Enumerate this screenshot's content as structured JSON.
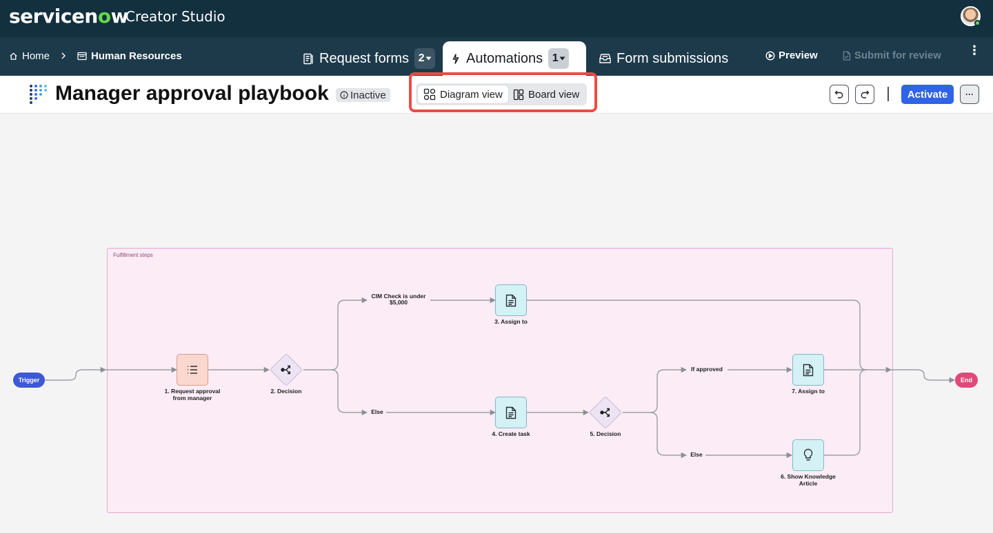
{
  "app": {
    "brand_name_prefix": "servicen",
    "brand_name_o": "o",
    "brand_name_suffix": "w",
    "product": "Creator Studio"
  },
  "breadcrumb": {
    "home": "Home",
    "current": "Human Resources"
  },
  "tabs": [
    {
      "label": "Request forms",
      "count": "2"
    },
    {
      "label": "Automations",
      "count": "1"
    },
    {
      "label": "Form submissions"
    }
  ],
  "nav_actions": {
    "preview": "Preview",
    "submit": "Submit for review",
    "more": "⋮"
  },
  "page": {
    "title": "Manager approval playbook",
    "status": "Inactive",
    "views": {
      "diagram": "Diagram view",
      "board": "Board view"
    },
    "activate": "Activate",
    "more": "···"
  },
  "diagram": {
    "group_label": "Fulfillment steps",
    "trigger": "Trigger",
    "end": "End",
    "nodes": {
      "step1": "1. Request approval from manager",
      "step2": "2. Decision",
      "step3": "3. Assign to",
      "step4": "4. Create task",
      "step5": "5. Decision",
      "step6": "6. Show Knowledge Article",
      "step7": "7. Assign to"
    },
    "edges": {
      "cim": "CIM Check is under $5,000",
      "else1": "Else",
      "approved": "If approved",
      "else2": "Else"
    }
  },
  "colors": {
    "topbar": "#13303f",
    "navbar": "#1d3a4b",
    "accent": "#2f63e8",
    "highlight": "#ec4c44",
    "trigger": "#3d58d8",
    "end": "#e0497a",
    "group_fill": "#fcecf6"
  }
}
